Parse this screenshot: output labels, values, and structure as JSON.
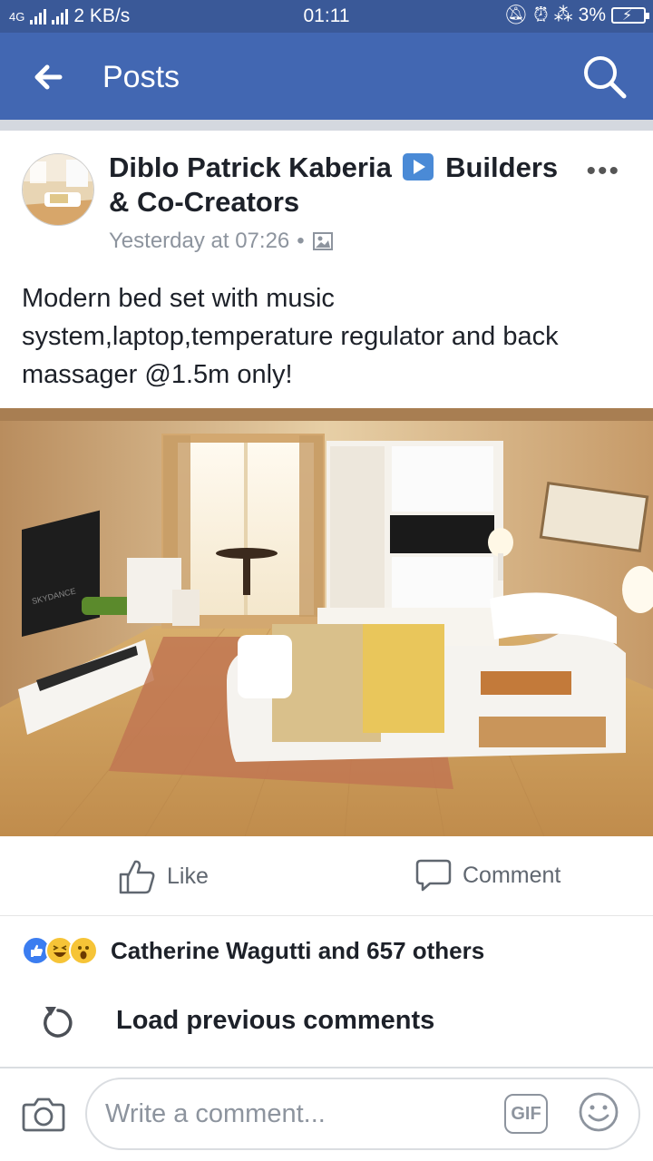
{
  "status_bar": {
    "network": "4G",
    "data_speed": "2 KB/s",
    "time": "01:11",
    "battery": "3%"
  },
  "header": {
    "title": "Posts",
    "back_icon": "arrow-left-icon",
    "search_icon": "search-icon",
    "bg_color": "#4267b2"
  },
  "post": {
    "author": "Diblo Patrick Kaberia",
    "author_suffix": "Builders & Co-Creators",
    "timestamp": "Yesterday at 07:26",
    "separator": "•",
    "privacy_icon": "photo-album-icon",
    "more_label": "•••",
    "text": "Modern bed set with music system,laptop,temperature regulator and back massager @1.5m only!",
    "image_brand": "SKYDANCE"
  },
  "actions": {
    "like_label": "Like",
    "comment_label": "Comment"
  },
  "reactions": {
    "icons": [
      "like-reaction-icon",
      "haha-reaction-icon",
      "wow-reaction-icon"
    ],
    "summary": "Catherine Wagutti and 657 others"
  },
  "comments": {
    "load_previous_label": "Load previous comments"
  },
  "composer": {
    "placeholder": "Write a comment...",
    "gif_label": "GIF"
  }
}
